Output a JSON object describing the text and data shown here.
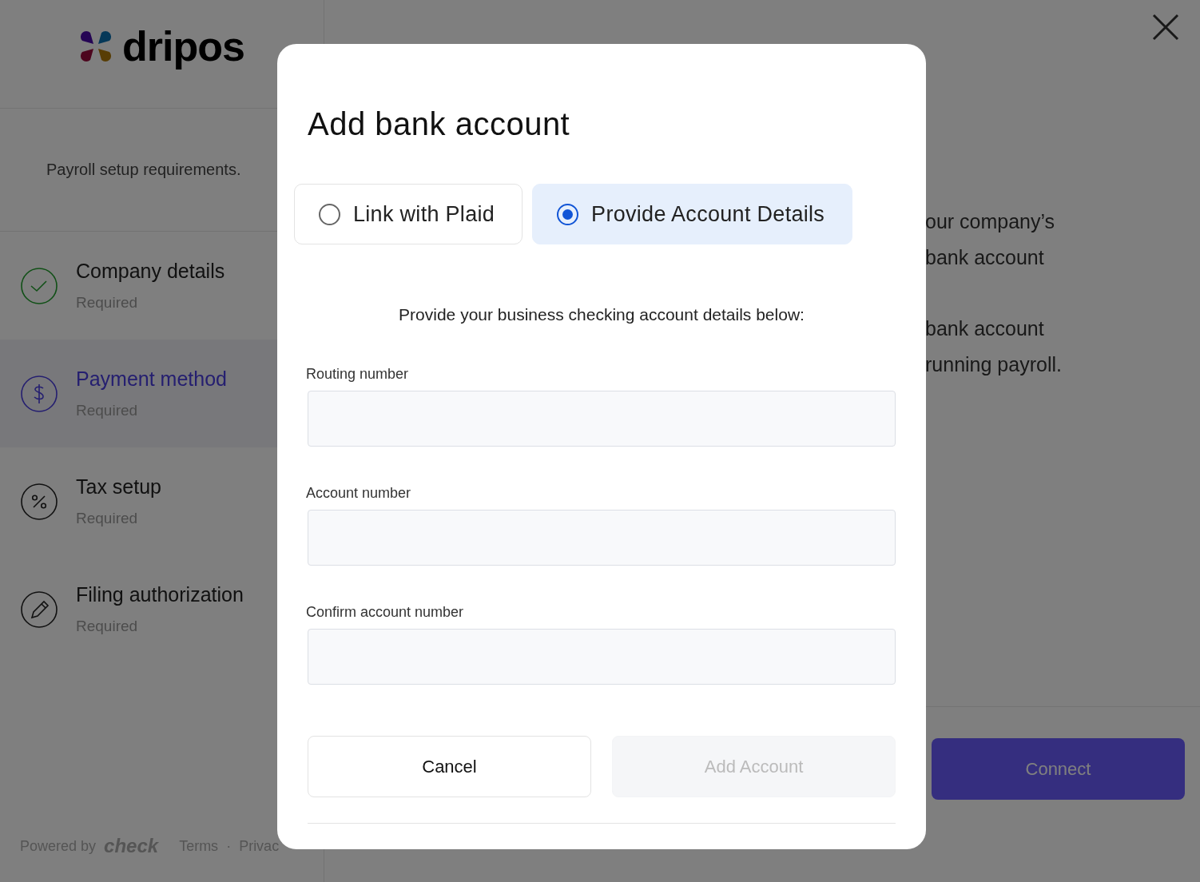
{
  "logo": {
    "text": "dripos"
  },
  "sidebar": {
    "subtitle": "Payroll setup requirements.",
    "steps": [
      {
        "title": "Company details",
        "status": "Required",
        "kind": "check",
        "selected": false
      },
      {
        "title": "Payment method",
        "status": "Required",
        "kind": "dollar",
        "selected": true
      },
      {
        "title": "Tax setup",
        "status": "Required",
        "kind": "percent",
        "selected": false
      },
      {
        "title": "Filing authorization",
        "status": "Required",
        "kind": "pencil",
        "selected": false
      }
    ],
    "footer": {
      "powered_by": "Powered by",
      "brand": "check",
      "links": [
        "Terms",
        "Privac"
      ],
      "separator": "·"
    }
  },
  "main": {
    "text_lines": [
      "our company’s",
      "bank account",
      "bank account",
      "running payroll."
    ],
    "connect_button": "Connect"
  },
  "modal": {
    "title": "Add bank account",
    "options": [
      {
        "label": "Link with Plaid",
        "selected": false
      },
      {
        "label": "Provide Account Details",
        "selected": true
      }
    ],
    "instructions": "Provide your business checking account details below:",
    "fields": [
      {
        "label": "Routing number"
      },
      {
        "label": "Account number"
      },
      {
        "label": "Confirm account number"
      }
    ],
    "cancel_button": "Cancel",
    "add_button": {
      "label": "Add Account",
      "disabled": true
    }
  }
}
